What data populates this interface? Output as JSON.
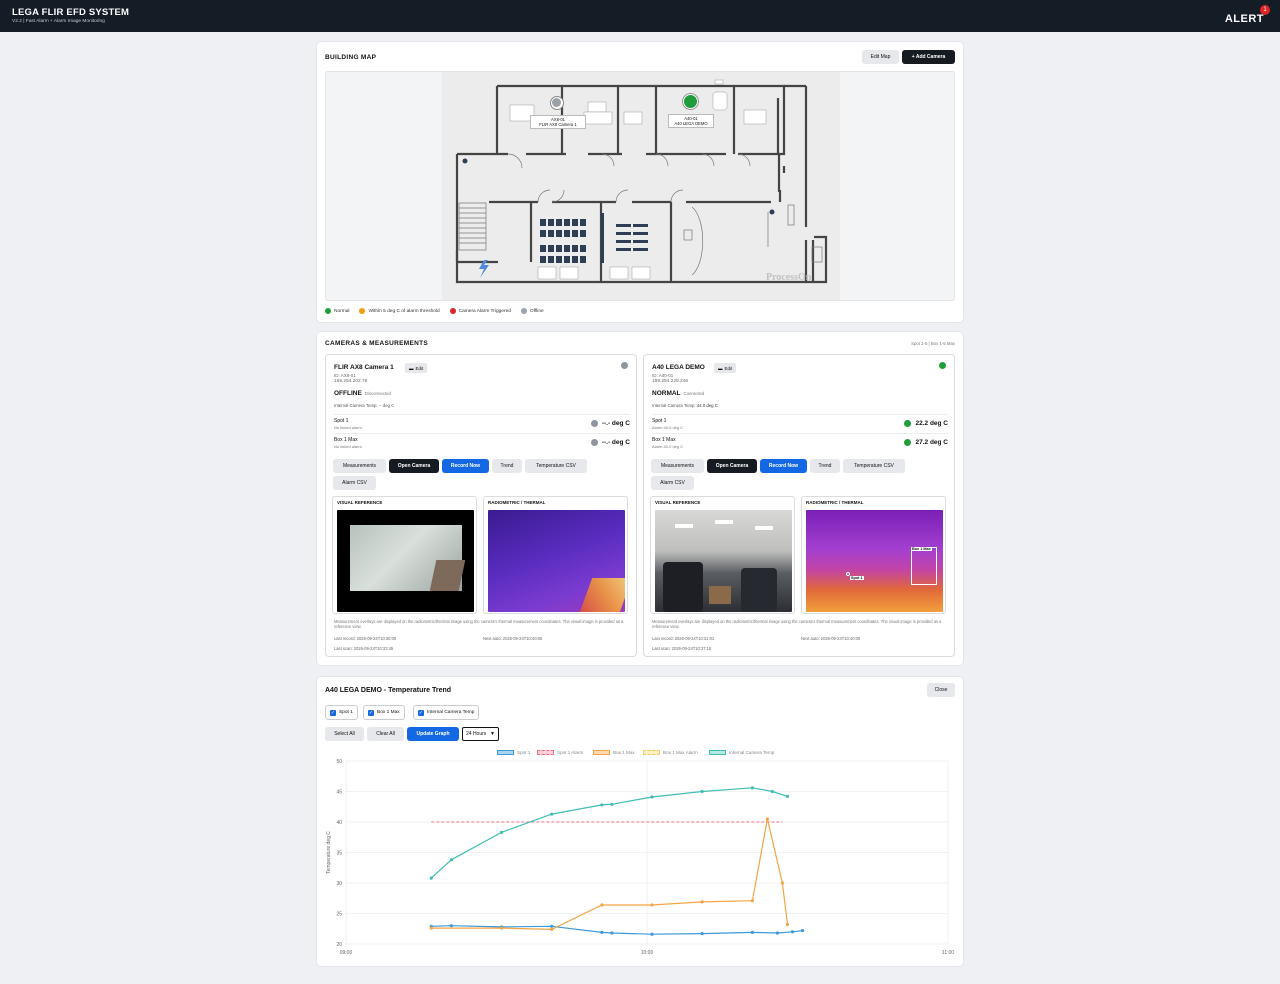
{
  "header": {
    "title": "LEGA FLIR EFD SYSTEM",
    "subtitle": "V2.2 | Fast Alarm + Alarm Image Monitoring",
    "alert_label": "ALERT",
    "alert_count": "1"
  },
  "building_map": {
    "title": "BUILDING MAP",
    "edit_label": "Edit Map",
    "add_label": "+ Add Camera",
    "watermark": "ProcessOn",
    "markers": [
      {
        "id_label": "AX8-01",
        "name": "FLIR AX8 Camera 1",
        "color": "#9aa0a6"
      },
      {
        "id_label": "A40-01",
        "name": "A40 LEGA DEMO",
        "color": "#1f9d3a"
      }
    ],
    "legend": [
      {
        "label": "Normal",
        "color": "#1f9d3a"
      },
      {
        "label": "Within 5 deg C of alarm threshold",
        "color": "#f59e0b"
      },
      {
        "label": "Camera Alarm Triggered",
        "color": "#dc2626"
      },
      {
        "label": "Offline",
        "color": "#9ca3af"
      }
    ]
  },
  "cameras_section": {
    "title": "CAMERAS & MEASUREMENTS",
    "summary": "Spot 1-5 | Box 1-5 Max",
    "cameras": [
      {
        "name": "FLIR AX8 Camera 1",
        "edit_label": "Edit",
        "id_line": "ID: AX8-01",
        "ip": "169.254.202.76",
        "state": "OFFLINE",
        "state_detail": "Disconnected",
        "internal_temp_label": "Internal Camera Temp:",
        "internal_temp_value": "-- deg C",
        "status_color": "#8f959c",
        "measurements": [
          {
            "name": "Spot 1",
            "alarm": "No linked alarm",
            "value": "--.- deg C",
            "color": "#8f959c"
          },
          {
            "name": "Box 1 Max",
            "alarm": "No linked alarm",
            "value": "--.- deg C",
            "color": "#8f959c"
          }
        ],
        "last_record": "Last record: 2026-09-24T10:30:00",
        "next_auto": "Next auto: 2026-09-24T10:40:00",
        "last_scan": "Last scan: 2026-09-24T10:33:45"
      },
      {
        "name": "A40 LEGA DEMO",
        "edit_label": "Edit",
        "id_line": "ID: A40-01",
        "ip": "169.254.229.246",
        "state": "NORMAL",
        "state_detail": "Connected",
        "internal_temp_label": "Internal Camera Temp:",
        "internal_temp_value": "44.0 deg C",
        "status_color": "#1f9d3a",
        "measurements": [
          {
            "name": "Spot 1",
            "alarm": "Alarm 40.0 deg C",
            "value": "22.2 deg C",
            "color": "#1f9d3a"
          },
          {
            "name": "Box 1 Max",
            "alarm": "Alarm 40.0 deg C",
            "value": "27.2 deg C",
            "color": "#1f9d3a"
          }
        ],
        "last_record": "Last record: 2026-09-24T10:31:01",
        "next_auto": "Next auto: 2026-09-24T10:40:00",
        "last_scan": "Last scan: 2026-09-24T10:37:18",
        "overlay_box": "Box 1 Max",
        "overlay_spot": "Spot 1"
      }
    ],
    "buttons": {
      "measurements": "Measurements",
      "open_camera": "Open Camera",
      "record_now": "Record Now",
      "trend": "Trend",
      "temperature_csv": "Temperature CSV",
      "alarm_csv": "Alarm CSV"
    },
    "visual_label": "VISUAL REFERENCE",
    "thermal_label": "RADIOMETRIC / THERMAL",
    "note": "Measurement overlays are displayed on the radiometric/thermal image using the camera's thermal measurement coordinates. The visual image is provided as a reference view."
  },
  "trend": {
    "title": "A40 LEGA DEMO - Temperature Trend",
    "close_label": "Close",
    "checkboxes": [
      "Spot 1",
      "Box 1 Max",
      "Internal Camera Temp"
    ],
    "select_all": "Select All",
    "clear_all": "Clear All",
    "update": "Update Graph",
    "range": "24 Hours"
  },
  "chart_data": {
    "type": "line",
    "title": "",
    "xlabel": "",
    "ylabel": "Temperature deg C",
    "xlim": [
      "09:00",
      "11:00"
    ],
    "ylim": [
      20,
      50
    ],
    "y_ticks": [
      20,
      25,
      30,
      35,
      40,
      45,
      50
    ],
    "x_ticks": [
      "09:00",
      "10:00",
      "11:00"
    ],
    "grid": true,
    "legend_position": "top",
    "series": [
      {
        "name": "Spot 1",
        "color": "#3b9ad9",
        "x": [
          "09:17",
          "09:21",
          "09:31",
          "09:41",
          "09:51",
          "09:53",
          "10:01",
          "10:11",
          "10:21",
          "10:26",
          "10:29",
          "10:31"
        ],
        "y": [
          22.9,
          23.0,
          22.8,
          22.9,
          21.9,
          21.8,
          21.6,
          21.7,
          21.9,
          21.8,
          22.0,
          22.2
        ]
      },
      {
        "name": "Spot 1 Alarm",
        "color": "#ef6b85",
        "dashed": true,
        "x": [
          "09:17",
          "10:27"
        ],
        "y": [
          40.0,
          40.0
        ]
      },
      {
        "name": "Box 1 Max",
        "color": "#f5a444",
        "x": [
          "09:17",
          "09:31",
          "09:41",
          "09:51",
          "10:01",
          "10:11",
          "10:21",
          "10:24",
          "10:27",
          "10:28"
        ],
        "y": [
          22.6,
          22.6,
          22.4,
          26.4,
          26.4,
          26.9,
          27.1,
          40.5,
          30.0,
          23.2
        ]
      },
      {
        "name": "Box 1 Max Alarm",
        "color": "#f7c95e",
        "dashed": true,
        "x": [],
        "y": []
      },
      {
        "name": "Internal Camera Temp",
        "color": "#3fbdb4",
        "x": [
          "09:17",
          "09:21",
          "09:31",
          "09:41",
          "09:51",
          "09:53",
          "10:01",
          "10:11",
          "10:21",
          "10:25",
          "10:28"
        ],
        "y": [
          30.8,
          33.8,
          38.3,
          41.3,
          42.8,
          42.9,
          44.1,
          45.0,
          45.6,
          45.0,
          44.2
        ]
      }
    ]
  }
}
